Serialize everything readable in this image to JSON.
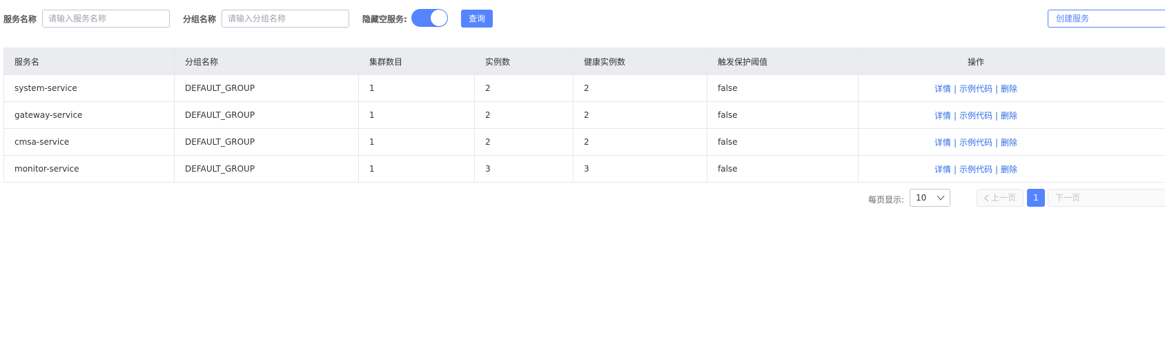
{
  "filters": {
    "service_name_label": "服务名称",
    "service_name_placeholder": "请输入服务名称",
    "group_name_label": "分组名称",
    "group_name_placeholder": "请输入分组名称",
    "hide_empty_label": "隐藏空服务:",
    "hide_empty_enabled": true,
    "query_label": "查询",
    "create_label": "创建服务"
  },
  "table": {
    "headers": {
      "service": "服务名",
      "group": "分组名称",
      "clusters": "集群数目",
      "instances": "实例数",
      "healthy": "健康实例数",
      "threshold": "触发保护阈值",
      "ops": "操作"
    },
    "rows": [
      {
        "service": "system-service",
        "group": "DEFAULT_GROUP",
        "clusters": "1",
        "instances": "2",
        "healthy": "2",
        "threshold": "false"
      },
      {
        "service": "gateway-service",
        "group": "DEFAULT_GROUP",
        "clusters": "1",
        "instances": "2",
        "healthy": "2",
        "threshold": "false"
      },
      {
        "service": "cmsa-service",
        "group": "DEFAULT_GROUP",
        "clusters": "1",
        "instances": "2",
        "healthy": "2",
        "threshold": "false"
      },
      {
        "service": "monitor-service",
        "group": "DEFAULT_GROUP",
        "clusters": "1",
        "instances": "3",
        "healthy": "3",
        "threshold": "false"
      }
    ],
    "row_actions": {
      "detail": "详情",
      "sample_code": "示例代码",
      "delete": "删除",
      "separator": "|"
    }
  },
  "pagination": {
    "page_size_label": "每页显示:",
    "page_size": "10",
    "prev_label": "上一页",
    "current_page": "1",
    "next_label": "下一页"
  },
  "colors": {
    "primary": "#5584ff",
    "link": "#2e6de6",
    "header_bg": "#ebecf0"
  }
}
